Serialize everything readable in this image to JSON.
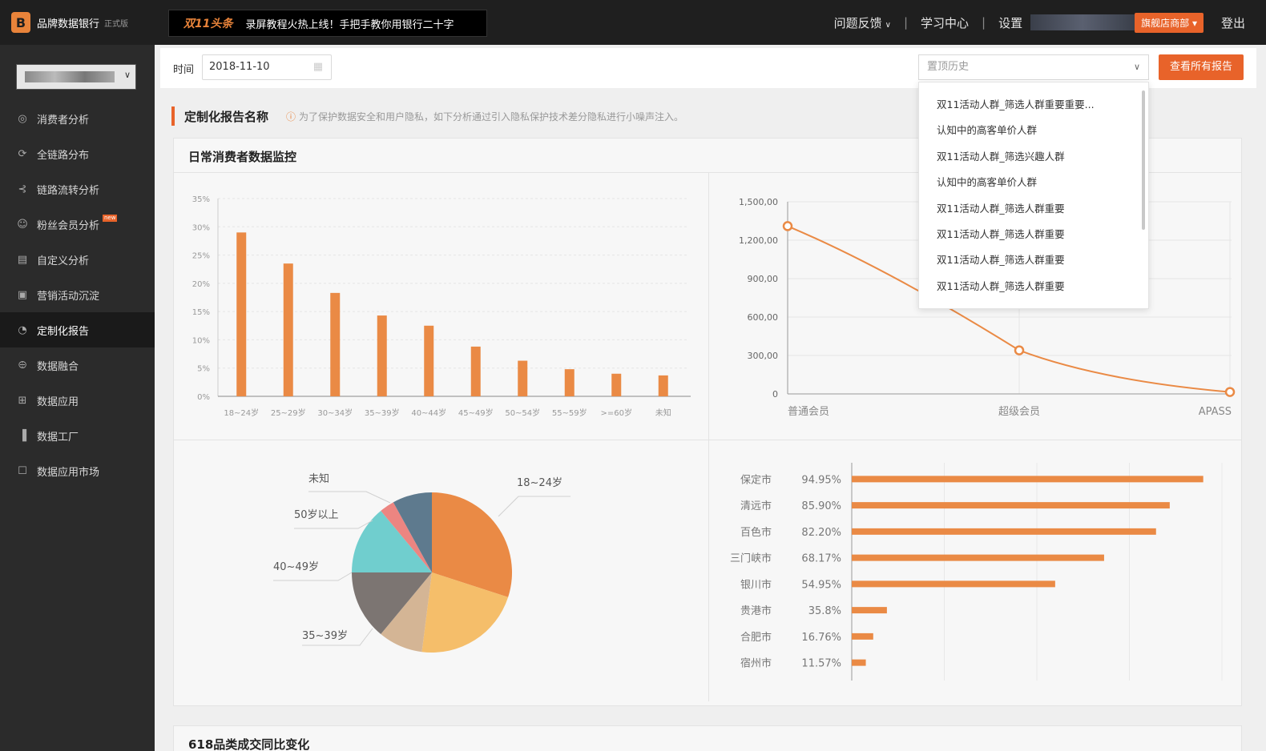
{
  "brand": {
    "logo_letter": "B",
    "name": "品牌数据银行",
    "version": "正式版"
  },
  "banner": {
    "tag": "双11头条",
    "text": "录屏教程火热上线！手把手教你用银行二十字"
  },
  "topnav": {
    "feedback": "问题反馈",
    "learning": "学习中心",
    "settings": "设置",
    "shop": "旗舰店商部",
    "logout": "登出"
  },
  "sidebar": {
    "items": [
      {
        "label": "消费者分析",
        "icon": "check-circle-icon"
      },
      {
        "label": "全链路分布",
        "icon": "refresh-circle-icon"
      },
      {
        "label": "链路流转分析",
        "icon": "flow-icon"
      },
      {
        "label": "粉丝会员分析",
        "icon": "user-icon",
        "badge": "new"
      },
      {
        "label": "自定义分析",
        "icon": "report-icon"
      },
      {
        "label": "营销活动沉淀",
        "icon": "clipboard-icon"
      },
      {
        "label": "定制化报告",
        "icon": "pie-icon",
        "active": true
      },
      {
        "label": "数据融合",
        "icon": "merge-icon"
      },
      {
        "label": "数据应用",
        "icon": "app-icon"
      },
      {
        "label": "数据工厂",
        "icon": "factory-icon"
      },
      {
        "label": "数据应用市场",
        "icon": "market-icon"
      }
    ]
  },
  "filter": {
    "time_label": "时间",
    "date_value": "2018-11-10",
    "history_placeholder": "置顶历史",
    "all_reports": "查看所有报告"
  },
  "report": {
    "title": "定制化报告名称",
    "notice": "为了保护数据安全和用户隐私，如下分析通过引入隐私保护技术差分隐私进行小噪声注入。"
  },
  "card": {
    "title": "日常消费者数据监控"
  },
  "history_items": [
    "双11活动人群_筛选人群重要重要...",
    "认知中的高客单价人群",
    "双11活动人群_筛选兴趣人群",
    "认知中的高客单价人群",
    "双11活动人群_筛选人群重要",
    "双11活动人群_筛选人群重要",
    "双11活动人群_筛选人群重要",
    "双11活动人群_筛选人群重要"
  ],
  "card2": {
    "title": "618品类成交同比变化"
  },
  "colors": {
    "accent": "#e8632a",
    "bar": "#ea8a45"
  },
  "chart_data": [
    {
      "type": "bar",
      "categories": [
        "18~24岁",
        "25~29岁",
        "30~34岁",
        "35~39岁",
        "40~44岁",
        "45~49岁",
        "50~54岁",
        "55~59岁",
        ">=60岁",
        "未知"
      ],
      "values": [
        29,
        23.5,
        18.3,
        14.3,
        12.5,
        8.8,
        6.3,
        4.8,
        4.0,
        3.7
      ],
      "ylim": [
        0,
        35
      ],
      "yticks": [
        "0%",
        "5%",
        "10%",
        "15%",
        "20%",
        "25%",
        "30%",
        "35%"
      ],
      "grid": true
    },
    {
      "type": "line",
      "categories": [
        "普通会员",
        "超级会员",
        "APASS"
      ],
      "values": [
        1310,
        340,
        15
      ],
      "ylim": [
        0,
        1500
      ],
      "yticks": [
        "0",
        "300,00",
        "600,00",
        "900,00",
        "1,200,00",
        "1,500,00"
      ],
      "grid": true
    },
    {
      "type": "pie",
      "slices": [
        {
          "label": "18~24岁",
          "value": 30,
          "color": "#ea8a45"
        },
        {
          "label": "",
          "value": 22,
          "color": "#f5be6a"
        },
        {
          "label": "",
          "value": 9,
          "color": "#d4b595"
        },
        {
          "label": "35~39岁",
          "value": 14,
          "color": "#7c7572"
        },
        {
          "label": "40~49岁",
          "value": 14,
          "color": "#70cece"
        },
        {
          "label": "50岁以上",
          "value": 3,
          "color": "#ec8581"
        },
        {
          "label": "未知",
          "value": 8,
          "color": "#5e7a8e"
        }
      ]
    },
    {
      "type": "bar",
      "orientation": "horizontal",
      "categories": [
        "保定市",
        "清远市",
        "百色市",
        "三门峡市",
        "银川市",
        "贵港市",
        "合肥市",
        "宿州市"
      ],
      "labels": [
        "94.95%",
        "85.90%",
        "82.20%",
        "68.17%",
        "54.95%",
        "35.8%",
        "16.76%",
        "11.57%"
      ],
      "values": [
        94.95,
        85.9,
        82.2,
        68.17,
        54.95,
        9.5,
        5.8,
        3.8
      ],
      "xlim": [
        0,
        100
      ],
      "grid": true
    }
  ]
}
